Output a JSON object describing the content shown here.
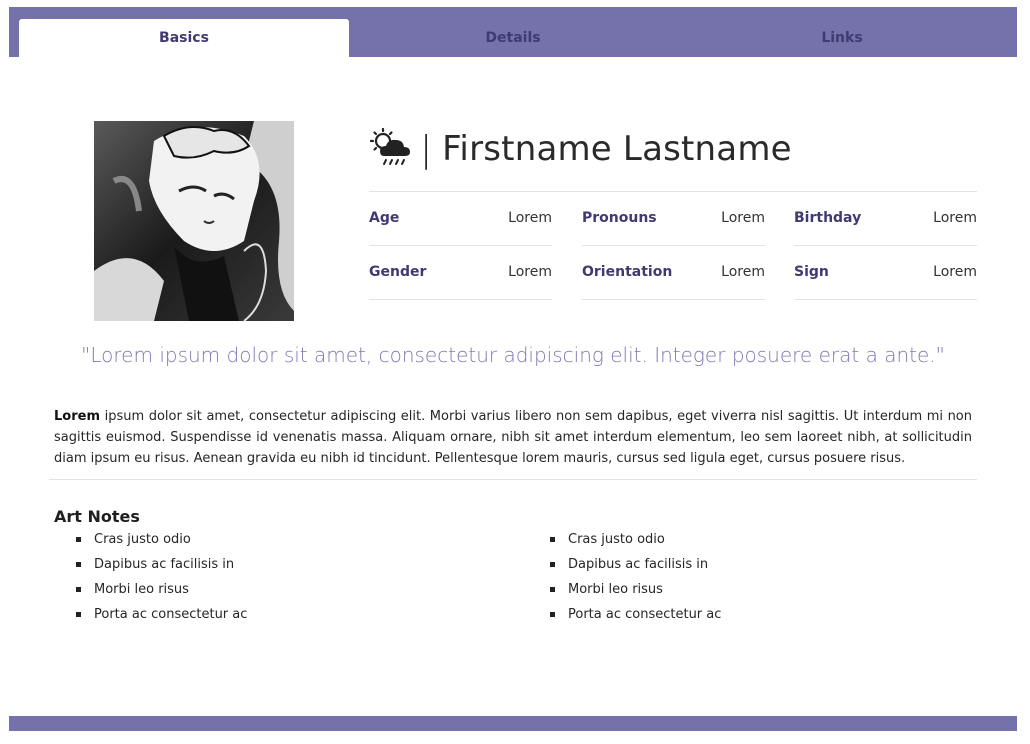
{
  "tabs": [
    {
      "label": "Basics",
      "active": true
    },
    {
      "label": "Details",
      "active": false
    },
    {
      "label": "Links",
      "active": false
    }
  ],
  "profile": {
    "weather_icon": "sun-behind-rain-cloud-icon",
    "separator": "|",
    "name": "Firstname Lastname"
  },
  "info": {
    "age": {
      "label": "Age",
      "value": "Lorem"
    },
    "pronouns": {
      "label": "Pronouns",
      "value": "Lorem"
    },
    "birthday": {
      "label": "Birthday",
      "value": "Lorem"
    },
    "gender": {
      "label": "Gender",
      "value": "Lorem"
    },
    "orientation": {
      "label": "Orientation",
      "value": "Lorem"
    },
    "sign": {
      "label": "Sign",
      "value": "Lorem"
    }
  },
  "quote": "\"Lorem ipsum dolor sit amet, consectetur adipiscing elit. Integer posuere erat a ante.\"",
  "bio": {
    "lead": "Lorem",
    "text": " ipsum dolor sit amet, consectetur adipiscing elit. Morbi varius libero non sem dapibus, eget viverra nisl sagittis. Ut interdum mi non sagittis euismod. Suspendisse id venenatis massa. Aliquam ornare, nibh sit amet interdum elementum, leo sem laoreet nibh, at sollicitudin diam ipsum eu risus. Aenean gravida eu nibh id tincidunt. Pellentesque lorem mauris, cursus sed ligula eget, cursus posuere risus."
  },
  "art_notes": {
    "title": "Art Notes",
    "left": [
      "Cras justo odio",
      "Dapibus ac facilisis in",
      "Morbi leo risus",
      "Porta ac consectetur ac"
    ],
    "right": [
      "Cras justo odio",
      "Dapibus ac facilisis in",
      "Morbi leo risus",
      "Porta ac consectetur ac"
    ]
  },
  "colors": {
    "accent": "#7571ab",
    "label": "#3f3a72",
    "quote": "#7e79b4"
  }
}
